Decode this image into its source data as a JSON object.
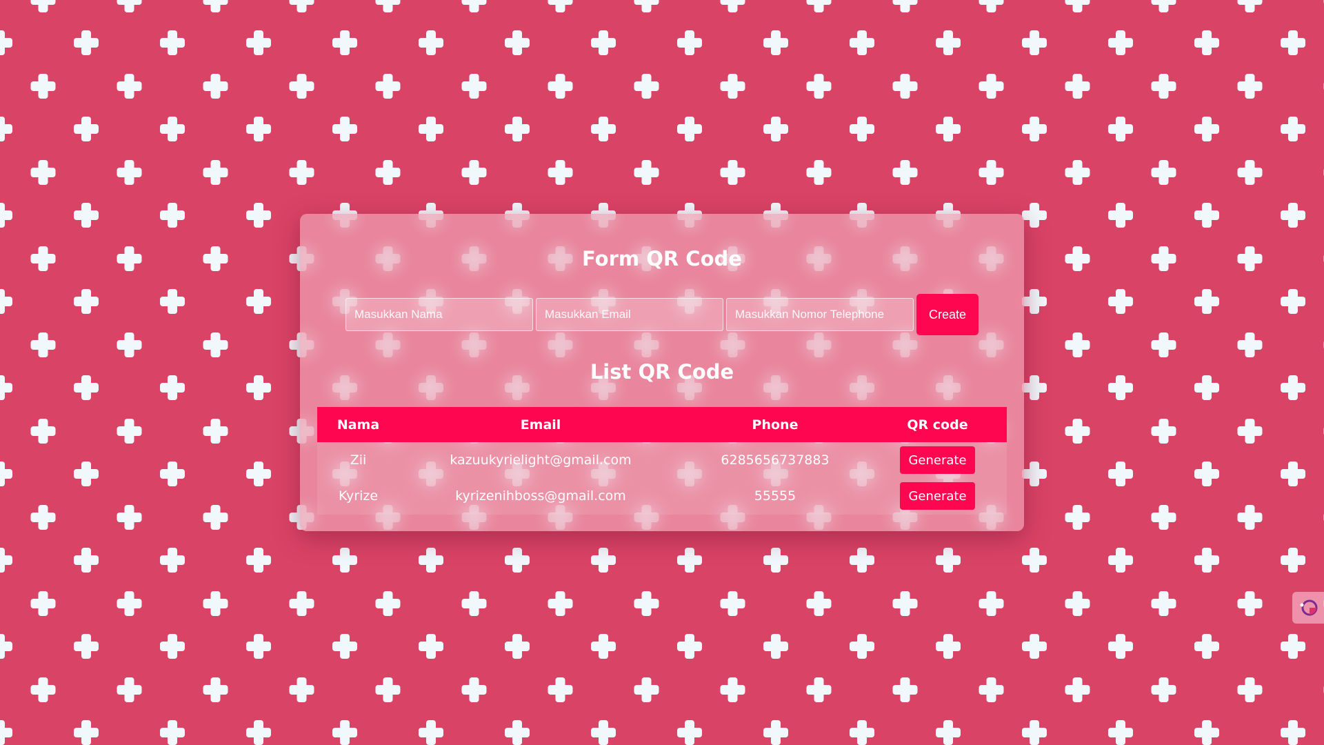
{
  "form": {
    "title": "Form QR Code",
    "name_placeholder": "Masukkan Nama",
    "email_placeholder": "Masukkan Email",
    "phone_placeholder": "Masukkan Nomor Telephone",
    "create_label": "Create"
  },
  "list": {
    "title": "List QR Code",
    "headers": [
      "Nama",
      "Email",
      "Phone",
      "QR code"
    ],
    "rows": [
      {
        "nama": "Zii",
        "email": "kazuukyrielight@gmail.com",
        "phone": "6285656737883",
        "action": "Generate"
      },
      {
        "nama": "Kyrize",
        "email": "kyrizenihboss@gmail.com",
        "phone": "55555",
        "action": "Generate"
      }
    ]
  },
  "colors": {
    "background": "#d94366",
    "pattern": "#f1f8fc",
    "accent": "#ff0650",
    "text": "#ffffff"
  },
  "icons": {
    "background_pattern": "plus-icon",
    "side_widget": "extension-icon"
  }
}
